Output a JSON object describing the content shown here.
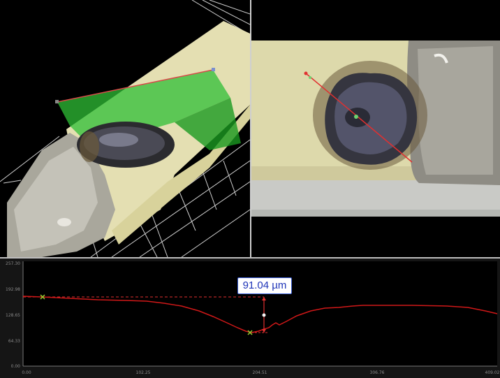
{
  "profile": {
    "measurement_label": "91.04  µm",
    "y_ticks": [
      "257.30",
      "192.98",
      "128.65",
      "64.33",
      "0.00"
    ],
    "x_ticks": [
      "0.00",
      "102.25",
      "204.51",
      "306.76",
      "409.02"
    ],
    "colors": {
      "profile_line": "#d01818",
      "marker": "#9acd32",
      "measure": "#e03030",
      "plot_bg": "#000000"
    }
  },
  "views": {
    "left": "3d-weld-view",
    "right": "top-down-weld-view"
  }
}
